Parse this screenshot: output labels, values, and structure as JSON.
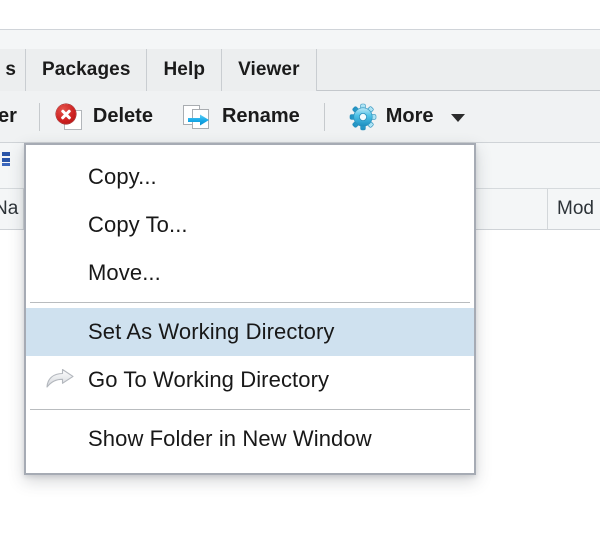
{
  "window": {
    "background_color": "#ffffff"
  },
  "tabbar": {
    "tabs": [
      {
        "label": "s",
        "clipped": true
      },
      {
        "label": "Packages",
        "clipped": false
      },
      {
        "label": "Help",
        "clipped": false
      },
      {
        "label": "Viewer",
        "clipped": false
      }
    ]
  },
  "toolbar": {
    "clipped_button_label": "er",
    "buttons": [
      {
        "label": "Delete",
        "icon": "delete-icon"
      },
      {
        "label": "Rename",
        "icon": "rename-icon"
      },
      {
        "label": "More",
        "icon": "gear-icon",
        "has_caret": true
      }
    ]
  },
  "files_pane": {
    "column_headers": [
      {
        "label": "Na"
      },
      {
        "label": "Mod"
      }
    ]
  },
  "menu": {
    "name": "more-dropdown-menu",
    "highlight_color": "#cfe1ef",
    "items": [
      {
        "label": "Copy...",
        "icon": null,
        "highlighted": false
      },
      {
        "label": "Copy To...",
        "icon": null,
        "highlighted": false
      },
      {
        "label": "Move...",
        "icon": null,
        "highlighted": false
      },
      {
        "separator_after": true
      },
      {
        "label": "Set As Working Directory",
        "icon": null,
        "highlighted": true
      },
      {
        "label": "Go To Working Directory",
        "icon": "curved-arrow-icon",
        "highlighted": false
      },
      {
        "separator_after": true
      },
      {
        "label": "Show Folder in New Window",
        "icon": null,
        "highlighted": false
      }
    ]
  }
}
